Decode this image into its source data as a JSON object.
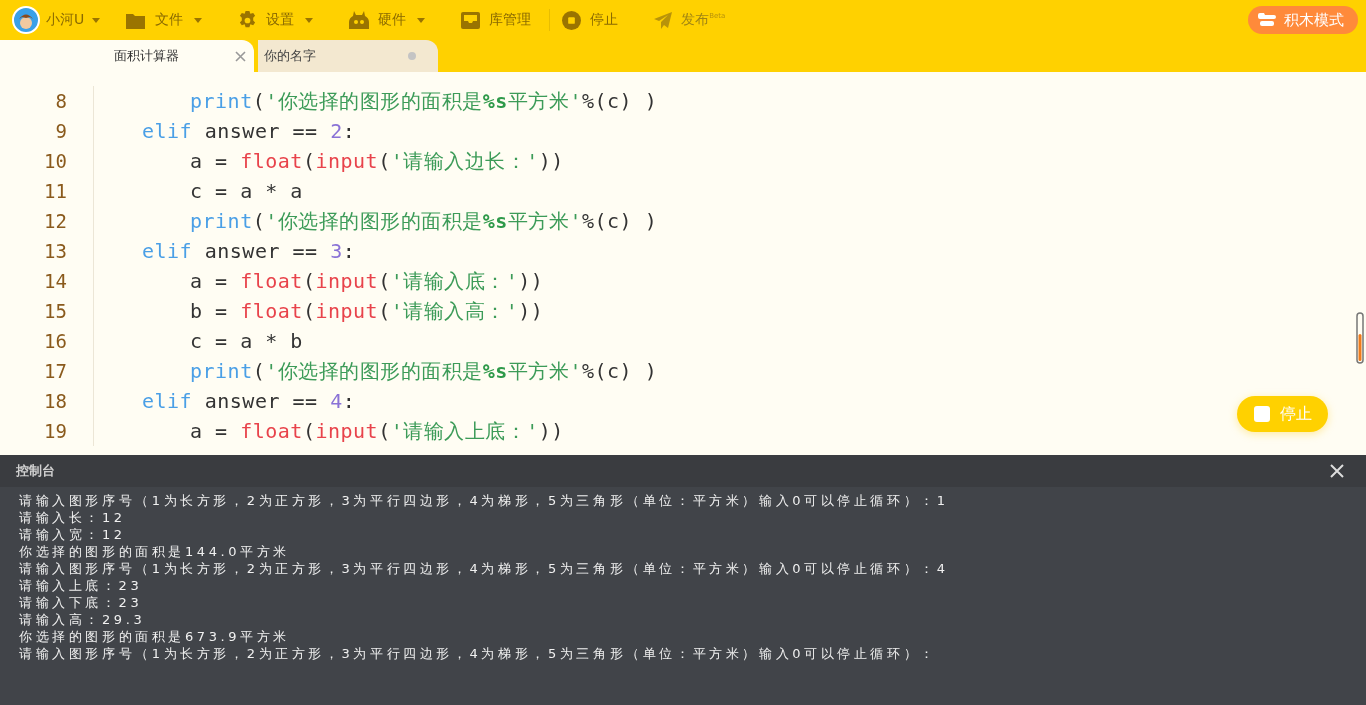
{
  "menu_bar": {
    "user": {
      "label": "小河U"
    },
    "items": [
      {
        "label": "文件",
        "kind": "folder",
        "dropdown": true
      },
      {
        "label": "设置",
        "kind": "gear",
        "dropdown": true
      },
      {
        "label": "硬件",
        "kind": "robot",
        "dropdown": true
      },
      {
        "label": "库管理",
        "kind": "tray",
        "dropdown": false
      },
      {
        "label": "停止",
        "kind": "stop",
        "dropdown": false
      },
      {
        "label": "发布$^{Beta}$",
        "kind": "plane",
        "dropdown": false
      }
    ],
    "mode_button": "积木模式"
  },
  "tabs": [
    {
      "label": "面积计算器",
      "selected": true,
      "modified": false
    },
    {
      "label": "你的名字",
      "selected": false,
      "modified": true
    }
  ],
  "editor": {
    "lines": [
      {
        "number": "8",
        "kind": "statement",
        "tokens": [
          {
            "kind": "kw",
            "text": "print"
          },
          {
            "kind": "plain",
            "text": "("
          },
          {
            "kind": "str",
            "text": "'你选择的图形的面积是"
          },
          {
            "kind": "fmt",
            "text": "%s"
          },
          {
            "kind": "str",
            "text": "平方米'"
          },
          {
            "kind": "plain",
            "text": "%(c) )"
          }
        ]
      },
      {
        "number": "9",
        "kind": "clause",
        "tokens": [
          {
            "kind": "kw",
            "text": "elif"
          },
          {
            "kind": "plain",
            "text": " answer == "
          },
          {
            "kind": "num",
            "text": "2"
          },
          {
            "kind": "plain",
            "text": ":"
          }
        ]
      },
      {
        "number": "10",
        "kind": "statement",
        "tokens": [
          {
            "kind": "plain",
            "text": "a = "
          },
          {
            "kind": "fn",
            "text": "float"
          },
          {
            "kind": "plain",
            "text": "("
          },
          {
            "kind": "fn",
            "text": "input"
          },
          {
            "kind": "plain",
            "text": "("
          },
          {
            "kind": "str",
            "text": "'请输入边长：'"
          },
          {
            "kind": "plain",
            "text": "))"
          }
        ]
      },
      {
        "number": "11",
        "kind": "statement",
        "tokens": [
          {
            "kind": "plain",
            "text": "c = a * a"
          }
        ]
      },
      {
        "number": "12",
        "kind": "statement",
        "tokens": [
          {
            "kind": "kw",
            "text": "print"
          },
          {
            "kind": "plain",
            "text": "("
          },
          {
            "kind": "str",
            "text": "'你选择的图形的面积是"
          },
          {
            "kind": "fmt",
            "text": "%s"
          },
          {
            "kind": "str",
            "text": "平方米'"
          },
          {
            "kind": "plain",
            "text": "%(c) )"
          }
        ]
      },
      {
        "number": "13",
        "kind": "clause",
        "tokens": [
          {
            "kind": "kw",
            "text": "elif"
          },
          {
            "kind": "plain",
            "text": " answer == "
          },
          {
            "kind": "num",
            "text": "3"
          },
          {
            "kind": "plain",
            "text": ":"
          }
        ]
      },
      {
        "number": "14",
        "kind": "statement",
        "tokens": [
          {
            "kind": "plain",
            "text": "a = "
          },
          {
            "kind": "fn",
            "text": "float"
          },
          {
            "kind": "plain",
            "text": "("
          },
          {
            "kind": "fn",
            "text": "input"
          },
          {
            "kind": "plain",
            "text": "("
          },
          {
            "kind": "str",
            "text": "'请输入底：'"
          },
          {
            "kind": "plain",
            "text": "))"
          }
        ]
      },
      {
        "number": "15",
        "kind": "statement",
        "tokens": [
          {
            "kind": "plain",
            "text": "b = "
          },
          {
            "kind": "fn",
            "text": "float"
          },
          {
            "kind": "plain",
            "text": "("
          },
          {
            "kind": "fn",
            "text": "input"
          },
          {
            "kind": "plain",
            "text": "("
          },
          {
            "kind": "str",
            "text": "'请输入高：'"
          },
          {
            "kind": "plain",
            "text": "))"
          }
        ]
      },
      {
        "number": "16",
        "kind": "statement",
        "tokens": [
          {
            "kind": "plain",
            "text": "c = a * b"
          }
        ]
      },
      {
        "number": "17",
        "kind": "statement",
        "tokens": [
          {
            "kind": "kw",
            "text": "print"
          },
          {
            "kind": "plain",
            "text": "("
          },
          {
            "kind": "str",
            "text": "'你选择的图形的面积是"
          },
          {
            "kind": "fmt",
            "text": "%s"
          },
          {
            "kind": "str",
            "text": "平方米'"
          },
          {
            "kind": "plain",
            "text": "%(c) )"
          }
        ]
      },
      {
        "number": "18",
        "kind": "clause",
        "tokens": [
          {
            "kind": "kw",
            "text": "elif"
          },
          {
            "kind": "plain",
            "text": " answer == "
          },
          {
            "kind": "num",
            "text": "4"
          },
          {
            "kind": "plain",
            "text": ":"
          }
        ]
      },
      {
        "number": "19",
        "kind": "statement",
        "tokens": [
          {
            "kind": "plain",
            "text": "a = "
          },
          {
            "kind": "fn",
            "text": "float"
          },
          {
            "kind": "plain",
            "text": "("
          },
          {
            "kind": "fn",
            "text": "input"
          },
          {
            "kind": "plain",
            "text": "("
          },
          {
            "kind": "str",
            "text": "'请输入上底：'"
          },
          {
            "kind": "plain",
            "text": "))"
          }
        ]
      }
    ]
  },
  "stop_button": "停止",
  "console": {
    "title": "控制台",
    "lines": [
      "请输入图形序号（1为长方形，2为正方形，3为平行四边形，4为梯形，5为三角形（单位：平方米）输入0可以停止循环）：1",
      "请输入长：12",
      "请输入宽：12",
      "你选择的图形的面积是144.0平方米",
      "请输入图形序号（1为长方形，2为正方形，3为平行四边形，4为梯形，5为三角形（单位：平方米）输入0可以停止循环）：4",
      "请输入上底：23",
      "请输入下底：23",
      "请输入高：29.3",
      "你选择的图形的面积是673.9平方米",
      "请输入图形序号（1为长方形，2为正方形，3为平行四边形，4为梯形，5为三角形（单位：平方米）输入0可以停止循环）："
    ]
  }
}
